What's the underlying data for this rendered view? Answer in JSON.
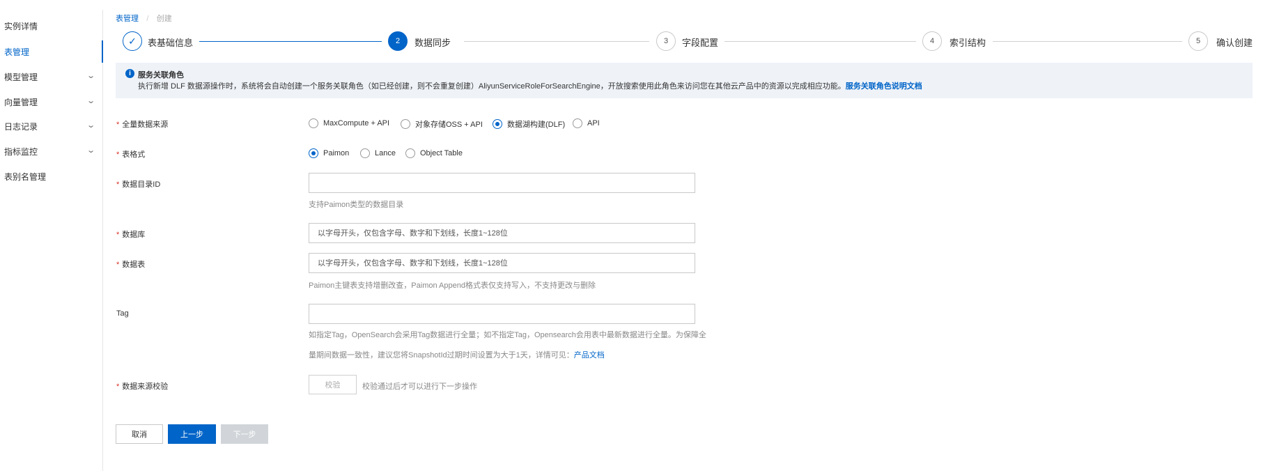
{
  "sidebar": {
    "items": [
      {
        "label": "实例详情",
        "expandable": false
      },
      {
        "label": "表管理",
        "expandable": false,
        "active": true
      },
      {
        "label": "模型管理",
        "expandable": true
      },
      {
        "label": "向量管理",
        "expandable": true
      },
      {
        "label": "日志记录",
        "expandable": true
      },
      {
        "label": "指标监控",
        "expandable": true
      },
      {
        "label": "表别名管理",
        "expandable": false
      }
    ]
  },
  "breadcrumb": {
    "parent": "表管理",
    "separator": "/",
    "current": "创建"
  },
  "steps": [
    {
      "number": "1",
      "label": "表基础信息",
      "status": "done"
    },
    {
      "number": "2",
      "label": "数据同步",
      "status": "active"
    },
    {
      "number": "3",
      "label": "字段配置",
      "status": "pending"
    },
    {
      "number": "4",
      "label": "索引结构",
      "status": "pending"
    },
    {
      "number": "5",
      "label": "确认创建",
      "status": "pending"
    }
  ],
  "alert": {
    "title": "服务关联角色",
    "text": "执行新增 DLF 数据源操作时，系统将会自动创建一个服务关联角色（如已经创建，则不会重复创建）AliyunServiceRoleForSearchEngine，开放搜索使用此角色来访问您在其他云产品中的资源以完成相应功能。",
    "link": "服务关联角色说明文档"
  },
  "form": {
    "source": {
      "label": "全量数据来源",
      "options": [
        "MaxCompute + API",
        "对象存储OSS + API",
        "数据湖构建(DLF)",
        "API"
      ],
      "selected": "数据湖构建(DLF)"
    },
    "format": {
      "label": "表格式",
      "options": [
        "Paimon",
        "Lance",
        "Object Table"
      ],
      "selected": "Paimon"
    },
    "catalog": {
      "label": "数据目录ID",
      "value": "",
      "help": "支持Paimon类型的数据目录"
    },
    "database": {
      "label": "数据库",
      "placeholder": "以字母开头，仅包含字母、数字和下划线，长度1~128位"
    },
    "table": {
      "label": "数据表",
      "placeholder": "以字母开头，仅包含字母、数字和下划线，长度1~128位",
      "help": "Paimon主键表支持增删改查，Paimon Append格式表仅支持写入，不支持更改与删除"
    },
    "tag": {
      "label": "Tag",
      "value": "",
      "help1": "如指定Tag，OpenSearch会采用Tag数据进行全量；如不指定Tag，Opensearch会用表中最新数据进行全量。为保障全",
      "help2": "量期间数据一致性，建议您将SnapshotId过期时间设置为大于1天，详情可见：",
      "help_link": "产品文档"
    },
    "verify": {
      "label": "数据来源校验",
      "button": "校验",
      "hint": "校验通过后才可以进行下一步操作"
    },
    "required_mark": "*"
  },
  "footer": {
    "cancel": "取消",
    "prev": "上一步",
    "next": "下一步"
  },
  "colors": {
    "primary": "#0064c8",
    "alert_bg": "#eff3f8",
    "disabled": "#d1d5d9"
  }
}
